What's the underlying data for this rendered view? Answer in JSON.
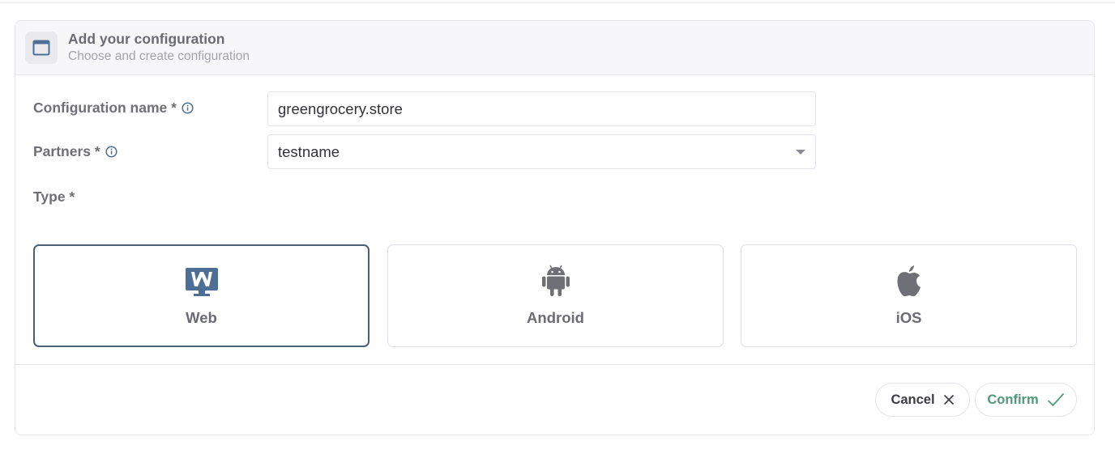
{
  "header": {
    "title": "Add your configuration",
    "subtitle": "Choose and create configuration",
    "icon": "window-icon"
  },
  "form": {
    "config_name": {
      "label": "Configuration name *",
      "value": "greengrocery.store",
      "info_icon": "info-icon"
    },
    "partners": {
      "label": "Partners *",
      "value": "testname",
      "info_icon": "info-icon"
    },
    "type": {
      "label": "Type *",
      "options": [
        {
          "label": "Web",
          "icon": "web-monitor-icon",
          "selected": true
        },
        {
          "label": "Android",
          "icon": "android-icon",
          "selected": false
        },
        {
          "label": "iOS",
          "icon": "apple-icon",
          "selected": false
        }
      ]
    }
  },
  "footer": {
    "cancel_label": "Cancel",
    "confirm_label": "Confirm"
  },
  "colors": {
    "selected_border": "#4d5f75",
    "confirm_text": "#4f9a78",
    "icon_blue": "#4e6f95",
    "icon_gray": "#6f6f76"
  }
}
